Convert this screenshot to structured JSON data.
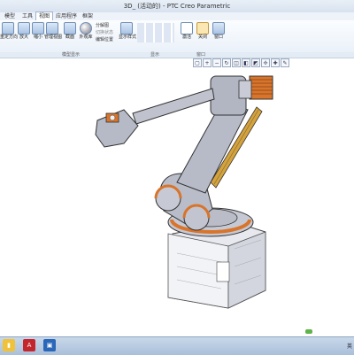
{
  "window": {
    "title": "3D_ (活动的) - PTC Creo Parametric"
  },
  "menu": {
    "tabs": [
      {
        "label": "模型"
      },
      {
        "label": "工具"
      },
      {
        "label": "视图"
      },
      {
        "label": "应用程序"
      },
      {
        "label": "框架"
      }
    ]
  },
  "ribbon": {
    "buttons": [
      {
        "label": "重定方向",
        "icon": "reorient-icon"
      },
      {
        "label": "放大",
        "icon": "zoom-in-icon"
      },
      {
        "label": "缩小",
        "icon": "zoom-out-icon"
      },
      {
        "label": "管理视图",
        "icon": "manage-views-icon"
      },
      {
        "label": "截面",
        "icon": "section-icon"
      },
      {
        "label": "外观库",
        "icon": "appearance-icon"
      },
      {
        "label": "显示样式",
        "icon": "display-style-icon"
      },
      {
        "label": "激活",
        "icon": "activate-icon"
      },
      {
        "label": "关闭",
        "icon": "close-window-icon"
      },
      {
        "label": "窗口",
        "icon": "windows-icon"
      }
    ],
    "small_items": [
      "分解图",
      "切换状态",
      "编辑位置"
    ],
    "groups": [
      "模型显示",
      "显示",
      "窗口"
    ]
  },
  "status": {
    "text": ""
  },
  "taskbar": {
    "tray_text": "英"
  },
  "colors": {
    "ribbon_accent": "#6f8db3",
    "robot_body": "#b9bdc9",
    "robot_accent": "#d9742b"
  }
}
